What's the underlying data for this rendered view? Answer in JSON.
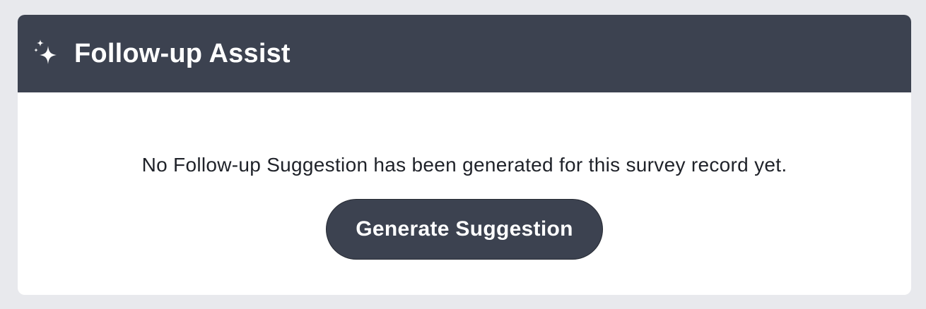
{
  "header": {
    "title": "Follow-up Assist",
    "icon": "sparkle-icon",
    "background_color": "#3c4250"
  },
  "body": {
    "message": "No Follow-up Suggestion has been generated for this survey record yet.",
    "generate_button_label": "Generate Suggestion"
  },
  "colors": {
    "page_background": "#e8e9ed",
    "accent": "#3c4250",
    "panel_background": "#ffffff"
  }
}
